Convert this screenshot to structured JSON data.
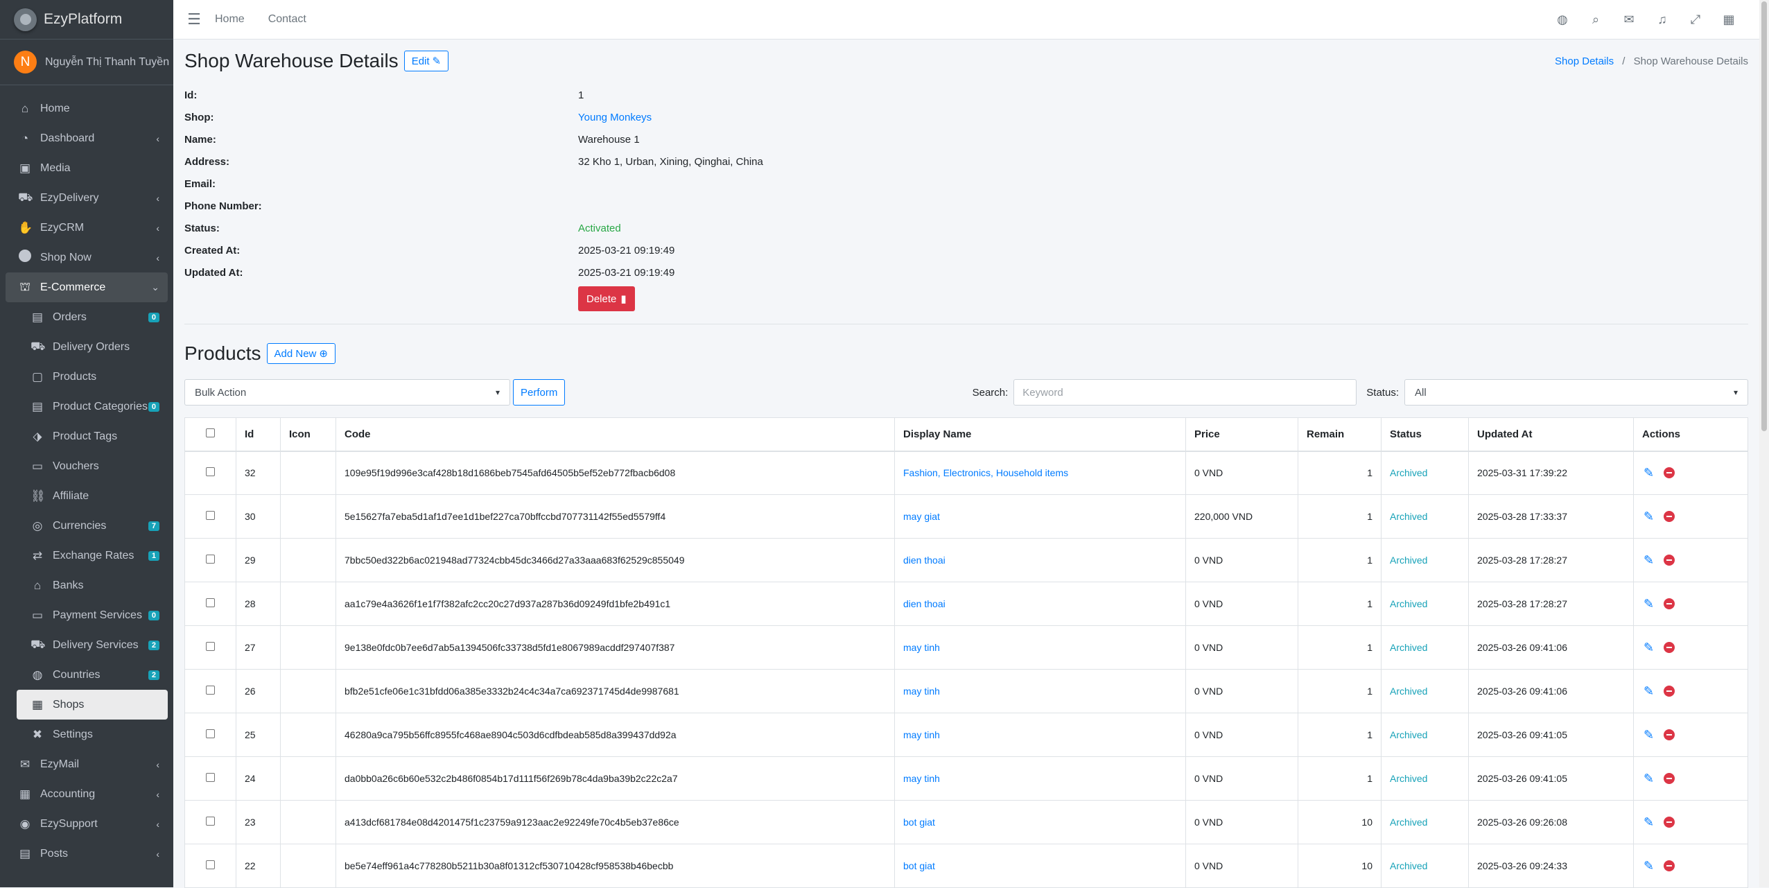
{
  "app": {
    "brand": "EzyPlatform",
    "user_initial": "N",
    "user_name": "Nguyễn Thị Thanh Tuyền"
  },
  "sidebar": {
    "items": [
      {
        "label": "Home",
        "icon": "home-icon",
        "glyph": "⌂",
        "chev": false,
        "badge": null,
        "sub": false
      },
      {
        "label": "Dashboard",
        "icon": "dashboard-icon",
        "glyph": "◔",
        "chev": true,
        "badge": null,
        "sub": false
      },
      {
        "label": "Media",
        "icon": "image-icon",
        "glyph": "▣",
        "chev": false,
        "badge": null,
        "sub": false
      },
      {
        "label": "EzyDelivery",
        "icon": "truck-icon",
        "glyph": "⛟",
        "chev": true,
        "badge": null,
        "sub": false
      },
      {
        "label": "EzyCRM",
        "icon": "handshake-icon",
        "glyph": "✋",
        "chev": true,
        "badge": null,
        "sub": false
      },
      {
        "label": "Shop Now",
        "icon": "circle-icon",
        "glyph": "●",
        "chev": true,
        "badge": null,
        "sub": false
      },
      {
        "label": "E-Commerce",
        "icon": "basket-icon",
        "glyph": "⛫",
        "chev": true,
        "badge": null,
        "sub": false,
        "open": true
      },
      {
        "label": "Orders",
        "icon": "receipt-icon",
        "glyph": "▤",
        "chev": false,
        "badge": "0",
        "sub": true
      },
      {
        "label": "Delivery Orders",
        "icon": "dolly-icon",
        "glyph": "⛟",
        "chev": false,
        "badge": null,
        "sub": true
      },
      {
        "label": "Products",
        "icon": "box-icon",
        "glyph": "▢",
        "chev": false,
        "badge": null,
        "sub": true
      },
      {
        "label": "Product Categories",
        "icon": "clipboard-icon",
        "glyph": "▤",
        "chev": false,
        "badge": "0",
        "sub": true
      },
      {
        "label": "Product Tags",
        "icon": "tags-icon",
        "glyph": "⬗",
        "chev": false,
        "badge": null,
        "sub": true
      },
      {
        "label": "Vouchers",
        "icon": "ticket-icon",
        "glyph": "▭",
        "chev": false,
        "badge": null,
        "sub": true
      },
      {
        "label": "Affiliate",
        "icon": "link-icon",
        "glyph": "⛓",
        "chev": false,
        "badge": null,
        "sub": true
      },
      {
        "label": "Currencies",
        "icon": "coins-icon",
        "glyph": "◎",
        "chev": false,
        "badge": "7",
        "sub": true
      },
      {
        "label": "Exchange Rates",
        "icon": "exchange-icon",
        "glyph": "⇄",
        "chev": false,
        "badge": "1",
        "sub": true
      },
      {
        "label": "Banks",
        "icon": "bank-icon",
        "glyph": "⌂",
        "chev": false,
        "badge": null,
        "sub": true
      },
      {
        "label": "Payment Services",
        "icon": "credit-card-icon",
        "glyph": "▭",
        "chev": false,
        "badge": "0",
        "sub": true
      },
      {
        "label": "Delivery Services",
        "icon": "truck-icon",
        "glyph": "⛟",
        "chev": false,
        "badge": "2",
        "sub": true
      },
      {
        "label": "Countries",
        "icon": "globe-icon",
        "glyph": "◍",
        "chev": false,
        "badge": "2",
        "sub": true
      },
      {
        "label": "Shops",
        "icon": "store-icon",
        "glyph": "▦",
        "chev": false,
        "badge": null,
        "sub": true,
        "active": true
      },
      {
        "label": "Settings",
        "icon": "tools-icon",
        "glyph": "✖",
        "chev": false,
        "badge": null,
        "sub": true
      },
      {
        "label": "EzyMail",
        "icon": "envelope-icon",
        "glyph": "✉",
        "chev": true,
        "badge": null,
        "sub": false
      },
      {
        "label": "Accounting",
        "icon": "calculator-icon",
        "glyph": "▦",
        "chev": true,
        "badge": null,
        "sub": false
      },
      {
        "label": "EzySupport",
        "icon": "life-ring-icon",
        "glyph": "◉",
        "chev": true,
        "badge": null,
        "sub": false
      },
      {
        "label": "Posts",
        "icon": "newspaper-icon",
        "glyph": "▤",
        "chev": true,
        "badge": null,
        "sub": false
      }
    ]
  },
  "navbar": {
    "home": "Home",
    "contact": "Contact"
  },
  "page": {
    "title": "Shop Warehouse Details",
    "edit_label": "Edit",
    "breadcrumb": {
      "parent": "Shop Details",
      "current": "Shop Warehouse Details"
    }
  },
  "details": {
    "id_label": "Id:",
    "id": "1",
    "shop_label": "Shop:",
    "shop": "Young Monkeys",
    "name_label": "Name:",
    "name": "Warehouse 1",
    "address_label": "Address:",
    "address": "32 Kho 1, Urban, Xining, Qinghai, China",
    "email_label": "Email:",
    "email": "",
    "phone_label": "Phone Number:",
    "phone": "",
    "status_label": "Status:",
    "status": "Activated",
    "created_label": "Created At:",
    "created": "2025-03-21 09:19:49",
    "updated_label": "Updated At:",
    "updated": "2025-03-21 09:19:49",
    "delete_label": "Delete"
  },
  "products": {
    "title": "Products",
    "add_new": "Add New",
    "bulk_action": "Bulk Action",
    "perform": "Perform",
    "search_label": "Search:",
    "search_placeholder": "Keyword",
    "status_label": "Status:",
    "status_value": "All",
    "columns": [
      "Id",
      "Icon",
      "Code",
      "Display Name",
      "Price",
      "Remain",
      "Status",
      "Updated At",
      "Actions"
    ],
    "rows": [
      {
        "id": "32",
        "code": "109e95f19d996e3caf428b18d1686beb7545afd64505b5ef52eb772fbacb6d08",
        "name": "Fashion, Electronics, Household items",
        "price": "0 VND",
        "remain": "1",
        "status": "Archived",
        "updated": "2025-03-31 17:39:22"
      },
      {
        "id": "30",
        "code": "5e15627fa7eba5d1af1d7ee1d1bef227ca70bffccbd707731142f55ed5579ff4",
        "name": "may giat",
        "price": "220,000 VND",
        "remain": "1",
        "status": "Archived",
        "updated": "2025-03-28 17:33:37"
      },
      {
        "id": "29",
        "code": "7bbc50ed322b6ac021948ad77324cbb45dc3466d27a33aaa683f62529c855049",
        "name": "dien thoai",
        "price": "0 VND",
        "remain": "1",
        "status": "Archived",
        "updated": "2025-03-28 17:28:27"
      },
      {
        "id": "28",
        "code": "aa1c79e4a3626f1e1f7f382afc2cc20c27d937a287b36d09249fd1bfe2b491c1",
        "name": "dien thoai",
        "price": "0 VND",
        "remain": "1",
        "status": "Archived",
        "updated": "2025-03-28 17:28:27"
      },
      {
        "id": "27",
        "code": "9e138e0fdc0b7ee6d7ab5a1394506fc33738d5fd1e8067989acddf297407f387",
        "name": "may tinh",
        "price": "0 VND",
        "remain": "1",
        "status": "Archived",
        "updated": "2025-03-26 09:41:06"
      },
      {
        "id": "26",
        "code": "bfb2e51cfe06e1c31bfdd06a385e3332b24c4c34a7ca692371745d4de9987681",
        "name": "may tinh",
        "price": "0 VND",
        "remain": "1",
        "status": "Archived",
        "updated": "2025-03-26 09:41:06"
      },
      {
        "id": "25",
        "code": "46280a9ca795b56ffc8955fc468ae8904c503d6cdfbdeab585d8a399437dd92a",
        "name": "may tinh",
        "price": "0 VND",
        "remain": "1",
        "status": "Archived",
        "updated": "2025-03-26 09:41:05"
      },
      {
        "id": "24",
        "code": "da0bb0a26c6b60e532c2b486f0854b17d111f56f269b78c4da9ba39b2c22c2a7",
        "name": "may tinh",
        "price": "0 VND",
        "remain": "1",
        "status": "Archived",
        "updated": "2025-03-26 09:41:05"
      },
      {
        "id": "23",
        "code": "a413dcf681784e08d4201475f1c23759a9123aac2e92249fe70c4b5eb37e86ce",
        "name": "bot giat",
        "price": "0 VND",
        "remain": "10",
        "status": "Archived",
        "updated": "2025-03-26 09:26:08"
      },
      {
        "id": "22",
        "code": "be5e74eff961a4c778280b5211b30a8f01312cf530710428cf958538b46becbb",
        "name": "bot giat",
        "price": "0 VND",
        "remain": "10",
        "status": "Archived",
        "updated": "2025-03-26 09:24:33"
      }
    ]
  },
  "colors": {
    "sidebar_bg": "#343a40",
    "primary": "#007bff",
    "danger": "#dc3545",
    "success": "#28a745",
    "info": "#17a2b8"
  }
}
